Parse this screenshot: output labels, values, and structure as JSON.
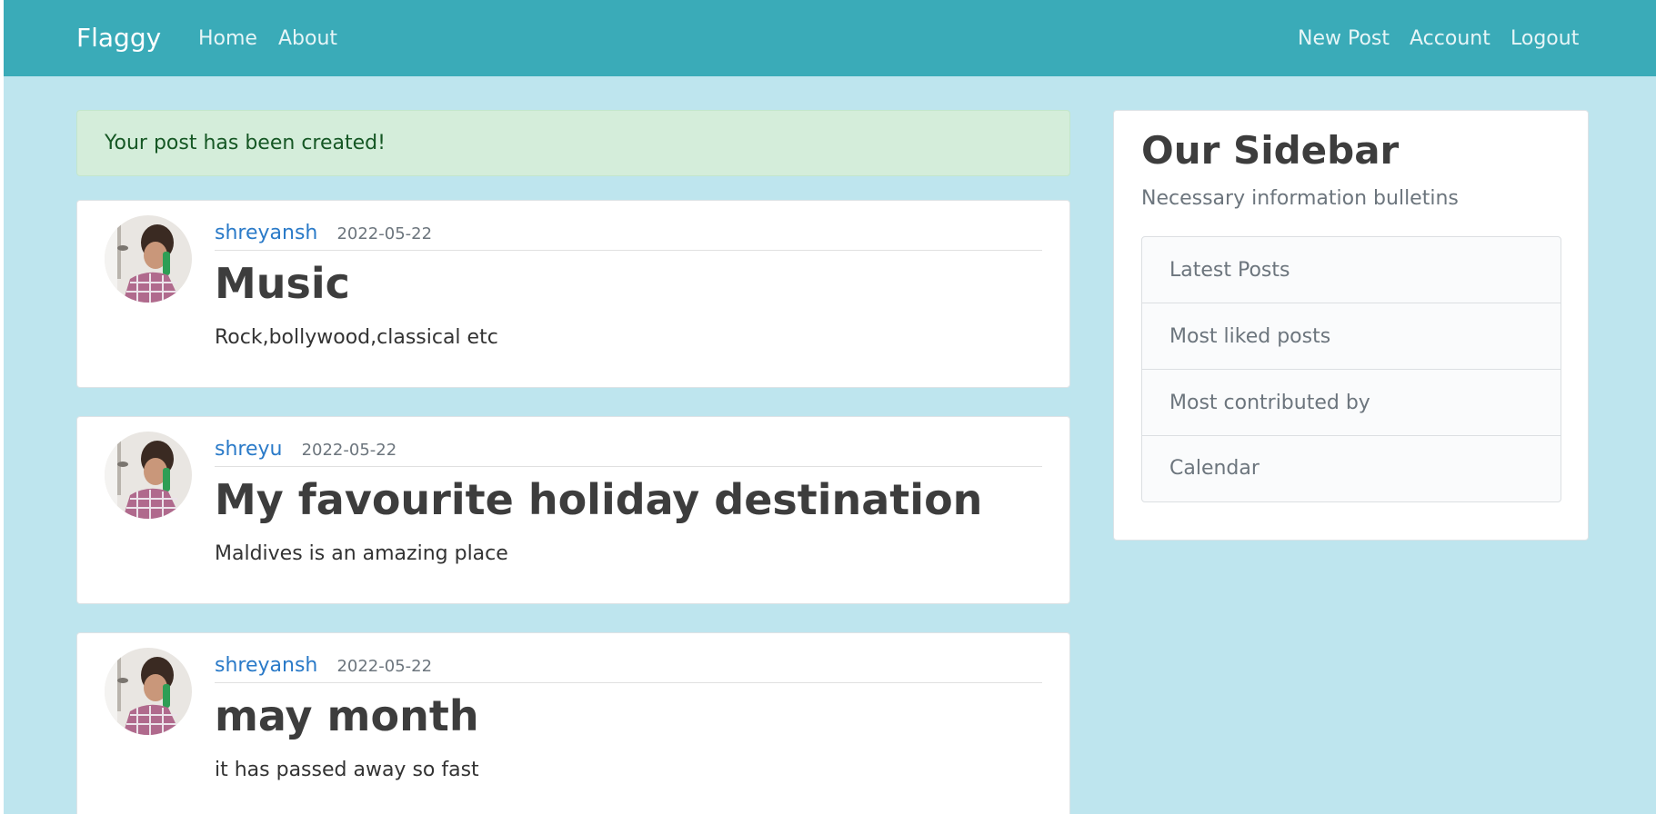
{
  "navbar": {
    "brand": "Flaggy",
    "left_links": [
      "Home",
      "About"
    ],
    "right_links": [
      "New Post",
      "Account",
      "Logout"
    ],
    "background": "#3aabb8"
  },
  "alert": {
    "message": "Your post has been created!"
  },
  "posts": [
    {
      "author": "shreyansh",
      "date": "2022-05-22",
      "title": "Music",
      "content": "Rock,bollywood,classical etc"
    },
    {
      "author": "shreyu",
      "date": "2022-05-22",
      "title": "My favourite holiday destination",
      "content": "Maldives is an amazing place"
    },
    {
      "author": "shreyansh",
      "date": "2022-05-22",
      "title": "may month",
      "content": "it has passed away so fast"
    }
  ],
  "sidebar": {
    "title": "Our Sidebar",
    "subtitle": "Necessary information bulletins",
    "items": [
      "Latest Posts",
      "Most liked posts",
      "Most contributed by",
      "Calendar"
    ]
  },
  "colors": {
    "page_background": "#bee5ee",
    "link": "#2a7ac8",
    "alert_background": "#d4edda"
  }
}
